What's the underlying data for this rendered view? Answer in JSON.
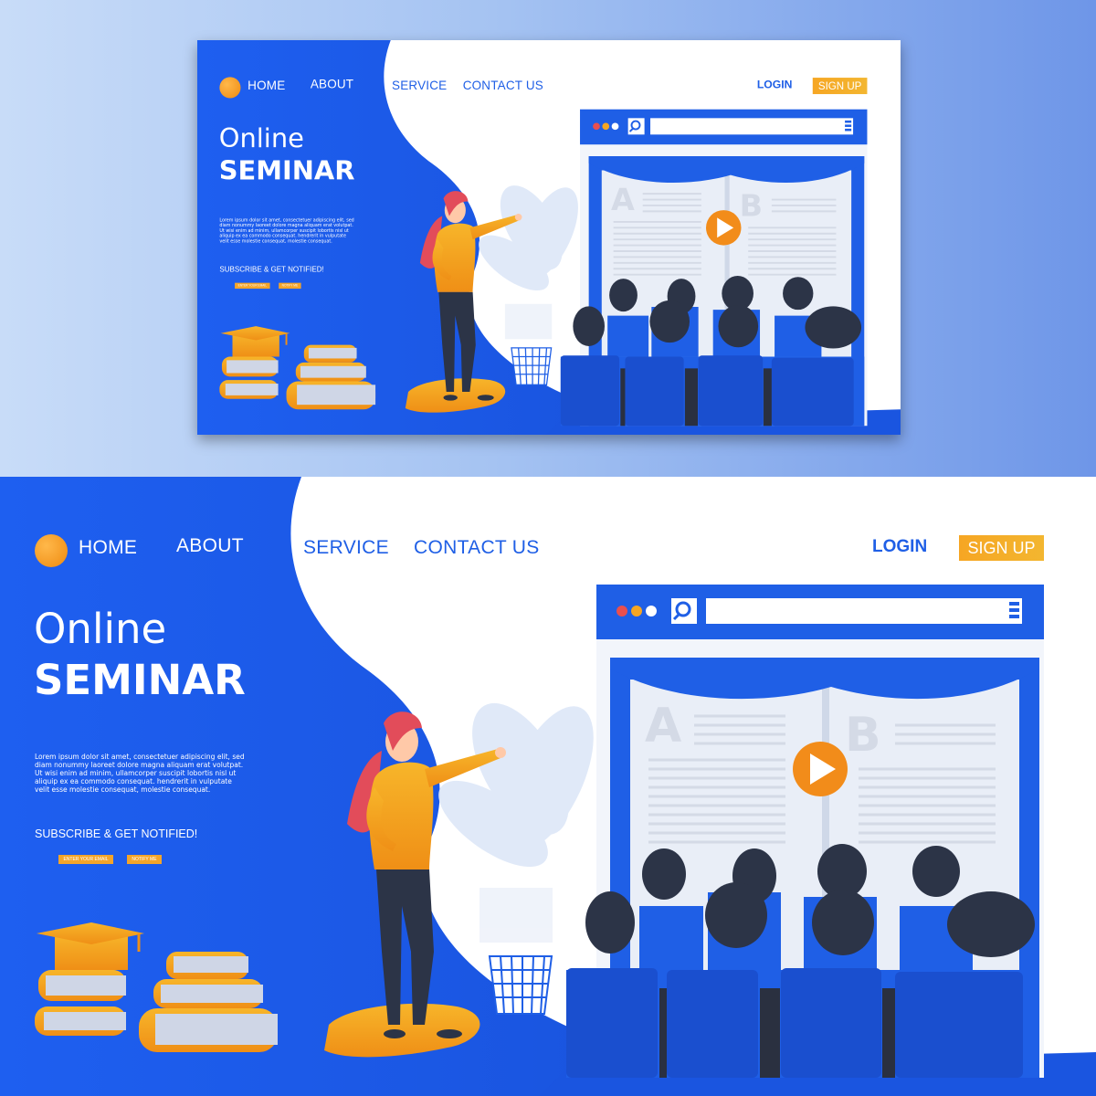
{
  "nav": {
    "home": "HOME",
    "about": "ABOUT",
    "service": "SERVICE",
    "contact": "CONTACT US",
    "login": "LOGIN",
    "signup": "SIGN UP"
  },
  "hero": {
    "title_line1": "Online",
    "title_line2": "SEMINAR",
    "body": "Lorem ipsum dolor sit amet, consectetuer adipiscing elit, sed diam nonummy laoreet dolore magna aliquam erat volutpat. Ut wisi enim ad minim, ullamcorper suscipit lobortis nisl ut aliquip ex ea commodo consequat. hendrerit in vulputate velit esse molestie consequat, molestie consequat.",
    "subscribe": "SUBSCRIBE & GET NOTIFIED!",
    "email_button": "ENTER YOUR EMAIL",
    "notify_button": "NOTIFY ME"
  },
  "video": {
    "page_a": "A",
    "page_b": "B"
  },
  "colors": {
    "primary_blue": "#1f5fe6",
    "accent_orange": "#f6a623",
    "dark_figure": "#2c3447"
  },
  "icons": [
    "logo-dot-icon",
    "search-icon",
    "menu-icon",
    "play-icon",
    "graduation-cap-icon",
    "trash-bin-icon"
  ]
}
